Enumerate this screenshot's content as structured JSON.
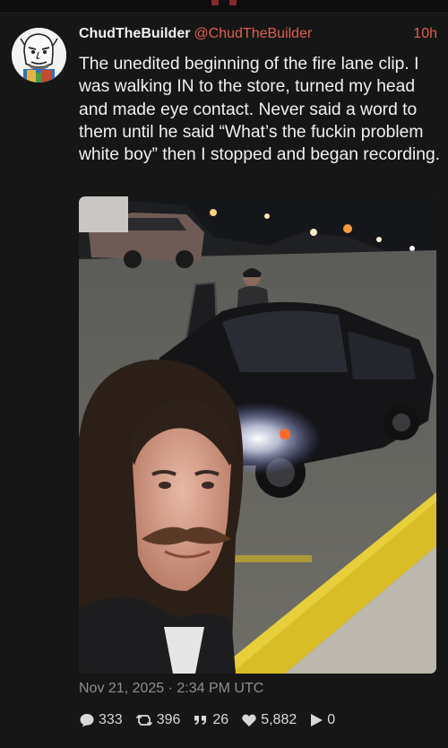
{
  "post": {
    "display_name": "ChudTheBuilder",
    "handle": "@ChudTheBuilder",
    "time_ago": "10h",
    "text": "The unedited beginning of the fire lane clip. I was walking IN to the store, turned my head and made eye contact. Never said a word to them until he said “What’s the fuckin problem white boy” then I stopped and began recording.",
    "timestamp": "Nov 21, 2025 · 2:34 PM UTC",
    "media_description": "Night selfie in a parking lot: a man with long hair and a mustache smiling in front of a dark sedan with headlights on and driver door open; another man standing by the door; yellow-painted fire lane curb.",
    "stats": {
      "replies": {
        "icon": "speech-bubble-icon",
        "count": "333"
      },
      "reposts": {
        "icon": "repost-icon",
        "count": "396"
      },
      "quotes": {
        "icon": "quote-icon",
        "count": "26"
      },
      "likes": {
        "icon": "heart-icon",
        "count": "5,882"
      },
      "views": {
        "icon": "play-icon",
        "count": "0"
      }
    }
  },
  "colors": {
    "background": "#161616",
    "accent": "#e0604f",
    "text": "#f0f0f0",
    "muted": "#8e8e8e"
  }
}
